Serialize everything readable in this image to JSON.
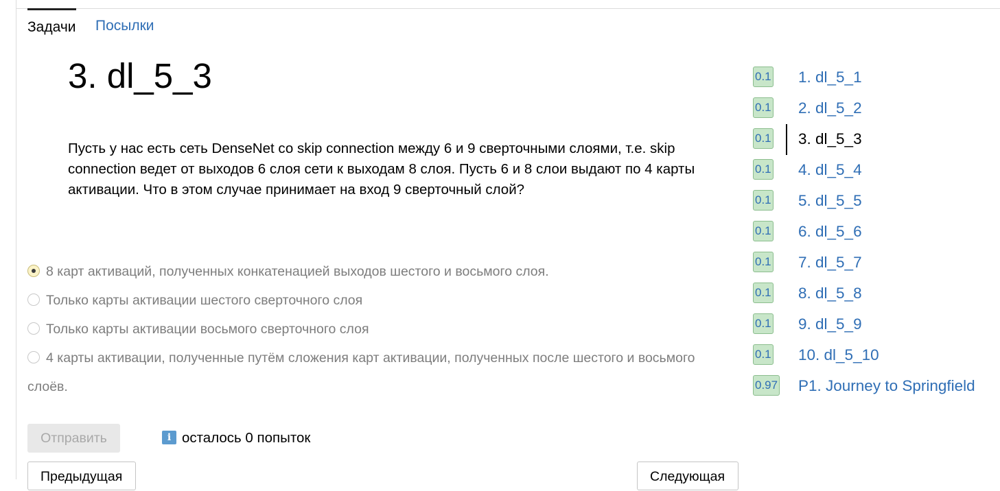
{
  "tabs": [
    {
      "label": "Задачи",
      "active": true
    },
    {
      "label": "Посылки",
      "active": false
    }
  ],
  "problem": {
    "title": "3. dl_5_3",
    "statement": "Пусть у нас есть сеть DenseNet со skip connection между 6 и 9 сверточными слоями, т.е. skip connection ведет от выходов 6 слоя сети к выходам 8 слоя. Пусть 6 и 8 слои выдают по 4 карты активации. Что в этом случае принимает на вход 9 сверточный слой?"
  },
  "options": [
    {
      "label": "8 карт активаций, полученных конкатенацией выходов шестого и восьмого слоя.",
      "checked": true
    },
    {
      "label": "Только карты активации шестого сверточного слоя",
      "checked": false
    },
    {
      "label": "Только карты активации восьмого сверточного слоя",
      "checked": false
    },
    {
      "label": "4 карты активации, полученные путём сложения карт активации, полученных после шестого и восьмого слоёв.",
      "checked": false
    }
  ],
  "submit_label": "Отправить",
  "info_icon": "info-icon",
  "attempts_text": "осталось 0 попыток",
  "nav": {
    "prev_label": "Предыдущая",
    "next_label": "Следующая"
  },
  "tasks": [
    {
      "score": "0.1",
      "name": "1. dl_5_1",
      "current": false
    },
    {
      "score": "0.1",
      "name": "2. dl_5_2",
      "current": false
    },
    {
      "score": "0.1",
      "name": "3. dl_5_3",
      "current": true
    },
    {
      "score": "0.1",
      "name": "4. dl_5_4",
      "current": false
    },
    {
      "score": "0.1",
      "name": "5. dl_5_5",
      "current": false
    },
    {
      "score": "0.1",
      "name": "6. dl_5_6",
      "current": false
    },
    {
      "score": "0.1",
      "name": "7. dl_5_7",
      "current": false
    },
    {
      "score": "0.1",
      "name": "8. dl_5_8",
      "current": false
    },
    {
      "score": "0.1",
      "name": "9. dl_5_9",
      "current": false
    },
    {
      "score": "0.1",
      "name": "10. dl_5_10",
      "current": false
    },
    {
      "score": "0.97",
      "name": "P1. Journey to Springfield",
      "current": false
    }
  ],
  "colors": {
    "link": "#2f6eb5",
    "score_bg": "#c8e6c9",
    "score_border": "#8bbd8d",
    "info_icon": "#5c9bcf"
  }
}
